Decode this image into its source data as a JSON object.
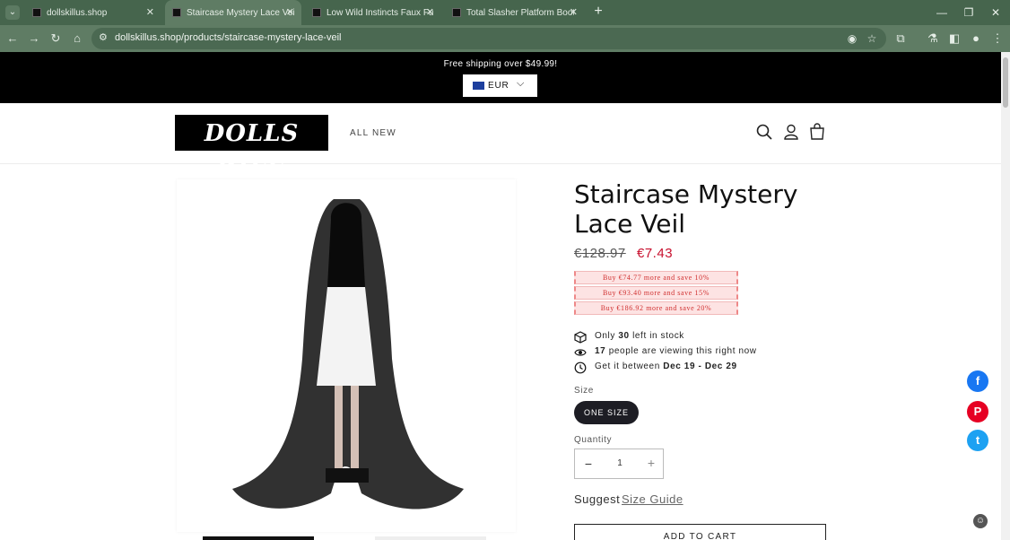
{
  "browser": {
    "tabs": [
      {
        "title": "dollskillus.shop",
        "active": false
      },
      {
        "title": "Staircase Mystery Lace Veil",
        "active": true
      },
      {
        "title": "Low Wild Instincts Faux Fur Boo",
        "active": false
      },
      {
        "title": "Total Slasher Platform Boots",
        "active": false
      }
    ],
    "url": "dollskillus.shop/products/staircase-mystery-lace-veil",
    "colors": {
      "tabbar": "#46654d",
      "toolbar": "#5f7c64"
    }
  },
  "announcement": {
    "text": "Free shipping over $49.99!",
    "currency": "EUR"
  },
  "header": {
    "logo_text": "DOLLS KILL",
    "nav_new": "ALL NEW"
  },
  "product": {
    "title": "Staircase Mystery Lace Veil",
    "price_old": "€128.97",
    "price_new": "€7.43",
    "offers": [
      "Buy €74.77 more and save 10%",
      "Buy €93.40 more and save 15%",
      "Buy €186.92 more and save 20%"
    ],
    "stock_prefix": "Only",
    "stock_count": "30",
    "stock_suffix": "left in stock",
    "viewers_count": "17",
    "viewers_text": "people are viewing this right now",
    "delivery_prefix": "Get it between",
    "delivery_range": "Dec 19 - Dec 29",
    "size_label": "Size",
    "size_option": "ONE SIZE",
    "quantity_label": "Quantity",
    "quantity_value": "1",
    "suggest_label": "Suggest",
    "size_guide": "Size Guide",
    "add_to_cart": "ADD TO CART"
  },
  "social": {
    "facebook": "f",
    "pinterest": "P",
    "twitter": "t",
    "colors": {
      "facebook": "#1877f2",
      "pinterest": "#e60023",
      "twitter": "#1da1f2"
    }
  }
}
